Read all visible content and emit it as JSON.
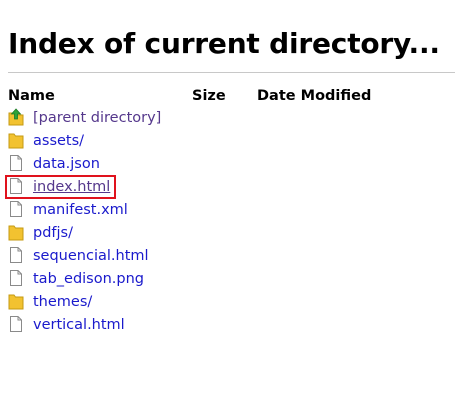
{
  "page": {
    "title": "Index of current directory..."
  },
  "table": {
    "headers": {
      "name": "Name",
      "size": "Size",
      "date_modified": "Date Modified"
    },
    "entries": [
      {
        "label": "[parent directory]",
        "icon": "parent-directory-icon"
      },
      {
        "label": "assets/",
        "icon": "folder-icon"
      },
      {
        "label": "data.json",
        "icon": "file-icon"
      },
      {
        "label": "index.html",
        "icon": "file-icon"
      },
      {
        "label": "manifest.xml",
        "icon": "file-icon"
      },
      {
        "label": "pdfjs/",
        "icon": "folder-icon"
      },
      {
        "label": "sequencial.html",
        "icon": "file-icon"
      },
      {
        "label": "tab_edison.png",
        "icon": "file-icon"
      },
      {
        "label": "themes/",
        "icon": "folder-icon"
      },
      {
        "label": "vertical.html",
        "icon": "file-icon"
      }
    ]
  },
  "colors": {
    "link": "#1a1acc",
    "visited_link": "#55388c",
    "highlight": "#e0121d",
    "folder": "#f2c230"
  }
}
